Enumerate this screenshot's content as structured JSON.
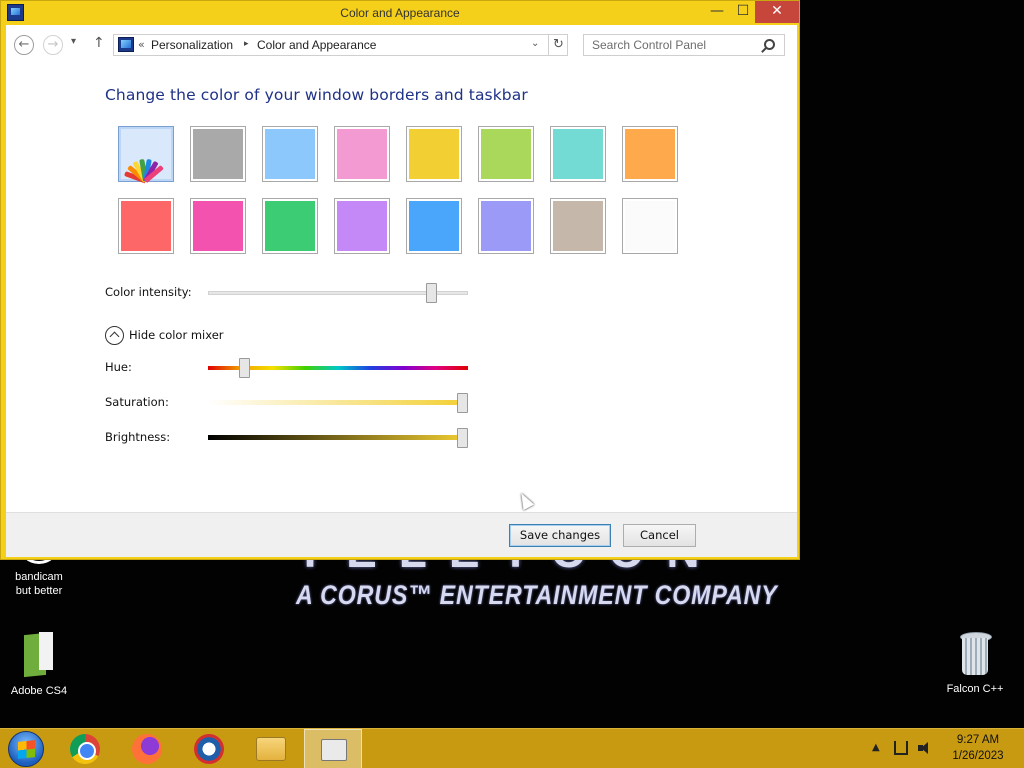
{
  "window": {
    "title": "Color and Appearance",
    "controls": {
      "minimize": "—",
      "maximize": "☐",
      "close": "✕"
    }
  },
  "navigation": {
    "back": "←",
    "forward": "→",
    "recent": "▾",
    "up": "↑",
    "address_prefix": "«",
    "breadcrumb": [
      "Personalization",
      "Color and Appearance"
    ],
    "breadcrumb_separator": "▸",
    "dropdown": "⌄",
    "refresh": "↻",
    "search_placeholder": "Search Control Panel"
  },
  "content": {
    "heading": "Change the color of your window borders and taskbar",
    "swatches": [
      {
        "color": "#dbe9fb",
        "icon": "color-palette-icon",
        "selected": true
      },
      {
        "color": "#a9a9a9"
      },
      {
        "color": "#8cc8fb"
      },
      {
        "color": "#f39ad3"
      },
      {
        "color": "#f2cf33"
      },
      {
        "color": "#a9d85a"
      },
      {
        "color": "#74dbd4"
      },
      {
        "color": "#fea94b"
      },
      {
        "color": "#fd6767"
      },
      {
        "color": "#f352ae"
      },
      {
        "color": "#3ccc74"
      },
      {
        "color": "#c488f7"
      },
      {
        "color": "#4aa6fa"
      },
      {
        "color": "#9b9bf7"
      },
      {
        "color": "#c5b8ab"
      },
      {
        "color": "#fbfbfb"
      }
    ],
    "color_intensity_label": "Color intensity:",
    "color_intensity_level": 0.86,
    "mixer_toggle_label": "Hide color mixer",
    "hue_label": "Hue:",
    "hue_level": 0.14,
    "saturation_label": "Saturation:",
    "saturation_level": 0.98,
    "brightness_label": "Brightness:",
    "brightness_level": 0.98
  },
  "footer": {
    "save_label": "Save changes",
    "cancel_label": "Cancel"
  },
  "desktop": {
    "logo_text": "A CORUS™ ENTERTAINMENT COMPANY",
    "logo_partial_text": "TELETOON",
    "icons": [
      {
        "label_line1": "bandicam",
        "label_line2": "but better"
      },
      {
        "label_line1": "Adobe CS4"
      },
      {
        "label_line1": "Falcon C++"
      }
    ]
  },
  "taskbar": {
    "apps": [
      "Windows Start",
      "Google Chrome",
      "Mozilla Firefox",
      "Opera",
      "File Explorer",
      "Control Panel"
    ],
    "tray_chevron": "▲",
    "time": "9:27 AM",
    "date": "1/26/2023"
  },
  "colors": {
    "window_border": "#f5d01b",
    "taskbar": "#c79a12",
    "heading": "#1e3287",
    "selected_accent": "#f2cf33"
  }
}
